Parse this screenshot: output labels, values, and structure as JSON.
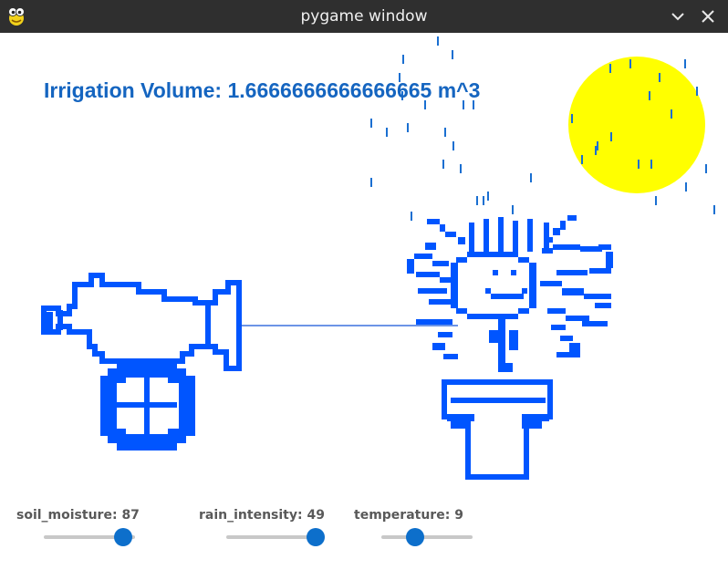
{
  "window": {
    "title": "pygame window",
    "icons": {
      "app": "pygame-snake-icon",
      "minimize": "chevron-down-icon",
      "close": "close-icon"
    }
  },
  "colors": {
    "titlebar": "#2f2f2f",
    "text_blue": "#1565c0",
    "pixel_blue": "#0055ff",
    "sun": "#ffff00",
    "rain": "#1a6fd1",
    "slider_track": "#c8c8c8",
    "slider_knob": "#0d6fcb",
    "label_gray": "#595959"
  },
  "irrigation": {
    "label": "Irrigation Volume: 1.6666666666666665 m^3"
  },
  "controls": [
    {
      "name": "soil_moisture",
      "label": "soil_moisture",
      "value": "87",
      "position": 0.87
    },
    {
      "name": "rain_intensity",
      "label": "rain_intensity",
      "value": "49",
      "position": 0.92
    },
    {
      "name": "temperature",
      "label": "temperature",
      "value": "9",
      "position": 0.37
    }
  ]
}
